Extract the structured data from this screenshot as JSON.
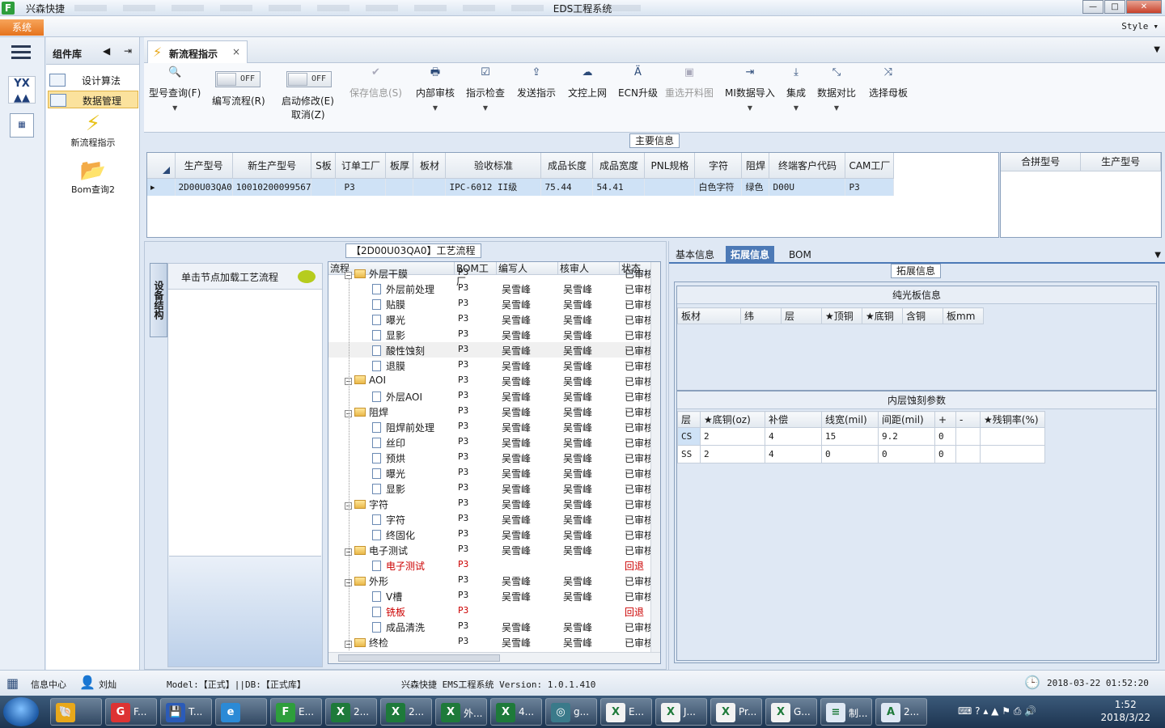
{
  "window": {
    "app_name": "兴森快捷",
    "title": "EDS工程系统",
    "min": "—",
    "max": "□",
    "close": "✕"
  },
  "menubar": {
    "system": "系统",
    "style": "Style"
  },
  "complib": {
    "title": "组件库",
    "prev": "◀",
    "next": "⇥",
    "items": [
      {
        "label": "设计算法"
      },
      {
        "label": "数据管理"
      }
    ],
    "big_items": [
      {
        "label": "新流程指示",
        "icon": "⚡"
      },
      {
        "label": "Bom查询2",
        "icon": "📂"
      }
    ]
  },
  "iconbar": {
    "yx": "YX"
  },
  "tab": {
    "label": "新流程指示",
    "close": "×"
  },
  "toolbar": {
    "items": [
      {
        "label": "型号查询(F)",
        "icon": "search-icon"
      },
      {
        "label": "编写流程(R)"
      },
      {
        "label": "启动修改(E)",
        "label2": "取消(Z)"
      },
      {
        "label": "保存信息(S)",
        "icon": "check-icon"
      },
      {
        "label": "内部审核",
        "icon": "print-icon"
      },
      {
        "label": "指示检查",
        "icon": "checkbox-icon"
      },
      {
        "label": "发送指示",
        "icon": "upload-icon"
      },
      {
        "label": "文控上网",
        "icon": "cloud-icon"
      },
      {
        "label": "ECN升级",
        "icon": "ecn-icon"
      },
      {
        "label": "重选开料图",
        "icon": "image-icon"
      },
      {
        "label": "MI数据导入",
        "icon": "import-icon"
      },
      {
        "label": "集成",
        "icon": "download-icon"
      },
      {
        "label": "数据对比",
        "icon": "compare-icon"
      },
      {
        "label": "选择母板",
        "icon": "shuffle-icon"
      }
    ],
    "toggle_off": "OFF"
  },
  "main_info": {
    "title": "主要信息",
    "columns": [
      "生产型号",
      "新生产型号",
      "S板",
      "订单工厂",
      "板厚",
      "板材",
      "验收标准",
      "成品长度",
      "成品宽度",
      "PNL规格",
      "字符",
      "阻焊",
      "终端客户代码",
      "CAM工厂"
    ],
    "row": [
      "2D00U03QA0",
      "10010200099567",
      "",
      "P3",
      "",
      "",
      "IPC-6012 II级",
      "75.44",
      "54.41",
      "",
      "白色字符",
      "绿色",
      "D00U",
      "P3"
    ],
    "row_marker": "▸",
    "side_columns": [
      "合拼型号",
      "生产型号"
    ]
  },
  "process": {
    "title": "【2D00U03QA0】工艺流程",
    "vtab": "设备结构",
    "load_hint": "单击节点加载工艺流程",
    "columns": [
      "流程",
      "BOM工厂",
      "编写人",
      "核审人",
      "状态"
    ],
    "rows": [
      {
        "name": "外层干膜",
        "kind": "folder",
        "factory": "P3",
        "writer": "",
        "reviewer": "",
        "status": "已审核",
        "clip": true
      },
      {
        "name": "外层前处理",
        "kind": "doc",
        "factory": "P3",
        "writer": "吴雪峰",
        "reviewer": "吴雪峰",
        "status": "已审核"
      },
      {
        "name": "贴膜",
        "kind": "doc",
        "factory": "P3",
        "writer": "吴雪峰",
        "reviewer": "吴雪峰",
        "status": "已审核"
      },
      {
        "name": "曝光",
        "kind": "doc",
        "factory": "P3",
        "writer": "吴雪峰",
        "reviewer": "吴雪峰",
        "status": "已审核"
      },
      {
        "name": "显影",
        "kind": "doc",
        "factory": "P3",
        "writer": "吴雪峰",
        "reviewer": "吴雪峰",
        "status": "已审核"
      },
      {
        "name": "酸性蚀刻",
        "kind": "doc",
        "factory": "P3",
        "writer": "吴雪峰",
        "reviewer": "吴雪峰",
        "status": "已审核",
        "hl": true
      },
      {
        "name": "退膜",
        "kind": "doc",
        "factory": "P3",
        "writer": "吴雪峰",
        "reviewer": "吴雪峰",
        "status": "已审核"
      },
      {
        "name": "AOI",
        "kind": "folder",
        "factory": "P3",
        "writer": "吴雪峰",
        "reviewer": "吴雪峰",
        "status": "已审核"
      },
      {
        "name": "外层AOI",
        "kind": "doc",
        "factory": "P3",
        "writer": "吴雪峰",
        "reviewer": "吴雪峰",
        "status": "已审核"
      },
      {
        "name": "阻焊",
        "kind": "folder",
        "factory": "P3",
        "writer": "吴雪峰",
        "reviewer": "吴雪峰",
        "status": "已审核"
      },
      {
        "name": "阻焊前处理",
        "kind": "doc",
        "factory": "P3",
        "writer": "吴雪峰",
        "reviewer": "吴雪峰",
        "status": "已审核"
      },
      {
        "name": "丝印",
        "kind": "doc",
        "factory": "P3",
        "writer": "吴雪峰",
        "reviewer": "吴雪峰",
        "status": "已审核"
      },
      {
        "name": "预烘",
        "kind": "doc",
        "factory": "P3",
        "writer": "吴雪峰",
        "reviewer": "吴雪峰",
        "status": "已审核"
      },
      {
        "name": "曝光",
        "kind": "doc",
        "factory": "P3",
        "writer": "吴雪峰",
        "reviewer": "吴雪峰",
        "status": "已审核"
      },
      {
        "name": "显影",
        "kind": "doc",
        "factory": "P3",
        "writer": "吴雪峰",
        "reviewer": "吴雪峰",
        "status": "已审核"
      },
      {
        "name": "字符",
        "kind": "folder",
        "factory": "P3",
        "writer": "吴雪峰",
        "reviewer": "吴雪峰",
        "status": "已审核"
      },
      {
        "name": "字符",
        "kind": "doc",
        "factory": "P3",
        "writer": "吴雪峰",
        "reviewer": "吴雪峰",
        "status": "已审核"
      },
      {
        "name": "终固化",
        "kind": "doc",
        "factory": "P3",
        "writer": "吴雪峰",
        "reviewer": "吴雪峰",
        "status": "已审核"
      },
      {
        "name": "电子测试",
        "kind": "folder",
        "factory": "P3",
        "writer": "吴雪峰",
        "reviewer": "吴雪峰",
        "status": "已审核"
      },
      {
        "name": "电子测试",
        "kind": "doc",
        "factory": "P3",
        "writer": "",
        "reviewer": "",
        "status": "回退",
        "red": true
      },
      {
        "name": "外形",
        "kind": "folder",
        "factory": "P3",
        "writer": "吴雪峰",
        "reviewer": "吴雪峰",
        "status": "已审核"
      },
      {
        "name": "V槽",
        "kind": "doc",
        "factory": "P3",
        "writer": "吴雪峰",
        "reviewer": "吴雪峰",
        "status": "已审核"
      },
      {
        "name": "铣板",
        "kind": "doc",
        "factory": "P3",
        "writer": "",
        "reviewer": "",
        "status": "回退",
        "red": true
      },
      {
        "name": "成品清洗",
        "kind": "doc",
        "factory": "P3",
        "writer": "吴雪峰",
        "reviewer": "吴雪峰",
        "status": "已审核"
      },
      {
        "name": "终检",
        "kind": "folder",
        "factory": "P3",
        "writer": "吴雪峰",
        "reviewer": "吴雪峰",
        "status": "已审核"
      }
    ]
  },
  "right": {
    "tabs": [
      "基本信息",
      "拓展信息",
      "BOM"
    ],
    "ext_title": "拓展信息",
    "bare_board": {
      "title": "纯光板信息",
      "columns": [
        "板材",
        "纬",
        "层",
        "★顶铜",
        "★底铜",
        "含铜",
        "板mm"
      ]
    },
    "inner_etch": {
      "title": "内层蚀刻参数",
      "columns": [
        "层",
        "★底铜(oz)",
        "补偿",
        "线宽(mil)",
        "间距(mil)",
        "+",
        "-",
        "★残铜率(%)"
      ],
      "rows": [
        [
          "CS",
          "2",
          "4",
          "15",
          "9.2",
          "0",
          "",
          ""
        ],
        [
          "SS",
          "2",
          "4",
          "0",
          "0",
          "0",
          "",
          ""
        ]
      ]
    }
  },
  "status": {
    "info_center": "信息中心",
    "user": "刘灿",
    "model": "Model:【正式】||DB:【正式库】",
    "version": "兴森快捷 EMS工程系统 Version: 1.0.1.410",
    "datetime": "2018-03-22 01:52:20"
  },
  "taskbar": {
    "tasks": [
      {
        "label": "",
        "color": "#e8a81b",
        "glyph": "🐚"
      },
      {
        "label": "F...",
        "color": "#d33",
        "glyph": "G"
      },
      {
        "label": "T...",
        "color": "#2b5bb8",
        "glyph": "💾"
      },
      {
        "label": "",
        "color": "#2b8ad6",
        "glyph": "e"
      },
      {
        "label": "E...",
        "color": "#2e9e3c",
        "glyph": "F"
      },
      {
        "label": "2...",
        "color": "#1e7a3a",
        "glyph": "X"
      },
      {
        "label": "2...",
        "color": "#1e7a3a",
        "glyph": "X"
      },
      {
        "label": "外...",
        "color": "#1e7a3a",
        "glyph": "X"
      },
      {
        "label": "4...",
        "color": "#1e7a3a",
        "glyph": "X"
      },
      {
        "label": "g...",
        "color": "#3a7a8a",
        "glyph": "◎"
      },
      {
        "label": "E...",
        "color": "#f2f2f2",
        "glyph": "X"
      },
      {
        "label": "J...",
        "color": "#f2f2f2",
        "glyph": "X"
      },
      {
        "label": "Pr...",
        "color": "#f2f2f2",
        "glyph": "X"
      },
      {
        "label": "G...",
        "color": "#f2f2f2",
        "glyph": "X"
      },
      {
        "label": "制...",
        "color": "#dfe8f4",
        "glyph": "≡"
      },
      {
        "label": "2...",
        "color": "#dfe8f4",
        "glyph": "A"
      }
    ],
    "time": "1:52",
    "date": "2018/3/22"
  }
}
